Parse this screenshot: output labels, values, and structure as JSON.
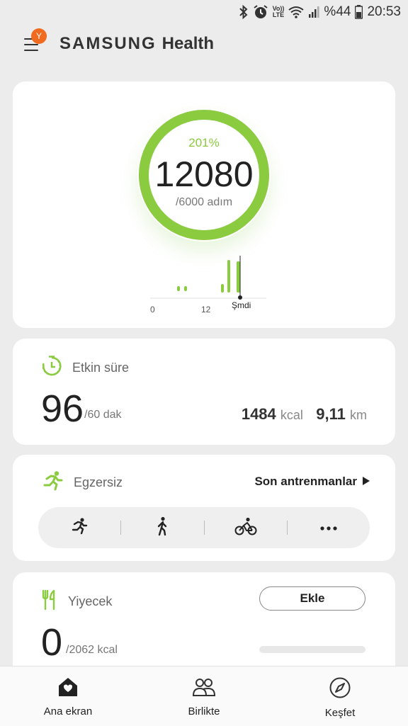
{
  "status_bar": {
    "battery_text": "%44",
    "time": "20:53",
    "volte_label": "Vo))",
    "lte_label": "LTE",
    "icons": [
      "bluetooth-icon",
      "alarm-icon",
      "volte-icon",
      "wifi-icon",
      "signal-icon",
      "battery-icon"
    ]
  },
  "app_bar": {
    "badge_letter": "Y",
    "brand_samsung": "SAMSUNG",
    "brand_health": "Health"
  },
  "steps": {
    "percent": "201%",
    "count": "12080",
    "goal": "/6000 adım",
    "ring_progress": 1.0,
    "ring_color": "#8acb3f",
    "chart_ticks": [
      "0",
      "12",
      "Şmdi"
    ]
  },
  "active_time": {
    "label": "Etkin süre",
    "value": "96",
    "goal": "/60 dak",
    "kcal_value": "1484",
    "kcal_unit": "kcal",
    "distance_value": "9,11",
    "distance_unit": "km"
  },
  "exercise": {
    "label": "Egzersiz",
    "recent_link": "Son antrenmanlar",
    "items": [
      "running-icon",
      "walking-icon",
      "cycling-icon",
      "more-icon"
    ]
  },
  "food": {
    "label": "Yiyecek",
    "add_label": "Ekle",
    "value": "0",
    "goal": "/2062 kcal"
  },
  "bottom_nav": {
    "home": "Ana ekran",
    "together": "Birlikte",
    "discover": "Keşfet"
  },
  "colors": {
    "accent_green": "#8acb3f",
    "badge_orange": "#f06a1f",
    "background": "#ececec"
  }
}
